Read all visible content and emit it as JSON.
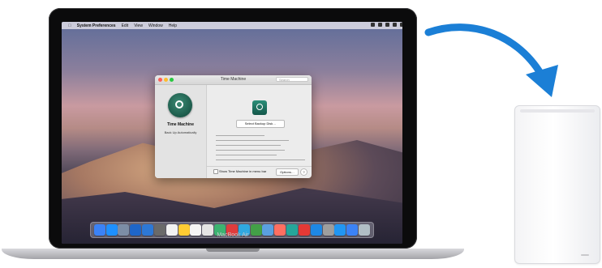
{
  "laptop": {
    "model_label": "MacBook Air"
  },
  "menubar": {
    "app_name": "System Preferences",
    "items": [
      "Edit",
      "View",
      "Window",
      "Help"
    ]
  },
  "window": {
    "title": "Time Machine",
    "search_placeholder": "Search",
    "app_name": "Time Machine",
    "auto_label": "Back Up Automatically",
    "select_disk_button": "Select Backup Disk…",
    "show_in_menu_bar": "Show Time Machine in menu bar",
    "options_button": "Options…",
    "help_button": "?"
  },
  "dock": {
    "app_colors": [
      "#3b82f6",
      "#1e90ff",
      "#7c8da6",
      "#1e66c9",
      "#2d78d6",
      "#6a6a6a",
      "#f2f2f2",
      "#ffcc33",
      "#f5f5f5",
      "#e5e5e5",
      "#3cb371",
      "#e03c3c",
      "#2fa8e0",
      "#43a047",
      "#5aa0e0",
      "#ff6f61",
      "#26a69a",
      "#e53935",
      "#1e88e5",
      "#9e9e9e",
      "#2196f3",
      "#3b82f6",
      "#b0bec5"
    ]
  },
  "colors": {
    "arrow": "#1b7fd6",
    "window_accent": "#1c5a4a"
  }
}
